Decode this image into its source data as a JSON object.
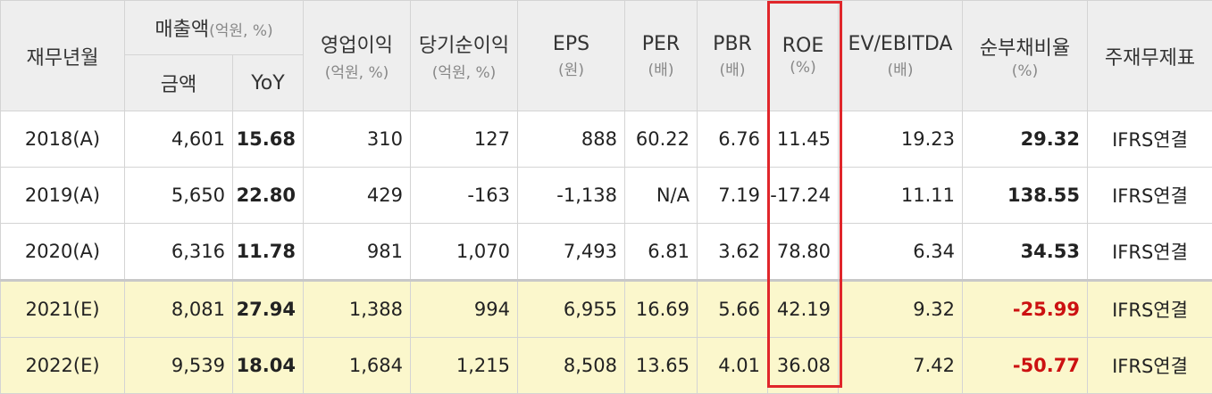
{
  "header": {
    "fiscal": "재무년월",
    "sales": {
      "label": "매출액",
      "unit": "(억원, %)",
      "amount": "금액",
      "yoy": "YoY"
    },
    "operating_profit": {
      "label": "영업이익",
      "unit": "(억원, %)"
    },
    "net_profit": {
      "label": "당기순이익",
      "unit": "(억원, %)"
    },
    "eps": {
      "label": "EPS",
      "unit": "(원)"
    },
    "per": {
      "label": "PER",
      "unit": "(배)"
    },
    "pbr": {
      "label": "PBR",
      "unit": "(배)"
    },
    "roe": {
      "label": "ROE",
      "unit": "(%)"
    },
    "ev_ebitda": {
      "label": "EV/EBITDA",
      "unit": "(배)"
    },
    "net_debt": {
      "label": "순부채비율",
      "unit": "(%)"
    },
    "statement": "주재무제표"
  },
  "rows": [
    {
      "year": "2018(A)",
      "amount": "4,601",
      "yoy": "15.68",
      "op": "310",
      "net": "127",
      "eps": "888",
      "per": "60.22",
      "pbr": "6.76",
      "roe": "11.45",
      "ev": "19.23",
      "debt": "29.32",
      "std": "IFRS연결"
    },
    {
      "year": "2019(A)",
      "amount": "5,650",
      "yoy": "22.80",
      "op": "429",
      "net": "-163",
      "eps": "-1,138",
      "per": "N/A",
      "pbr": "7.19",
      "roe": "-17.24",
      "ev": "11.11",
      "debt": "138.55",
      "std": "IFRS연결"
    },
    {
      "year": "2020(A)",
      "amount": "6,316",
      "yoy": "11.78",
      "op": "981",
      "net": "1,070",
      "eps": "7,493",
      "per": "6.81",
      "pbr": "3.62",
      "roe": "78.80",
      "ev": "6.34",
      "debt": "34.53",
      "std": "IFRS연결"
    },
    {
      "year": "2021(E)",
      "amount": "8,081",
      "yoy": "27.94",
      "op": "1,388",
      "net": "994",
      "eps": "6,955",
      "per": "16.69",
      "pbr": "5.66",
      "roe": "42.19",
      "ev": "9.32",
      "debt": "-25.99",
      "std": "IFRS연결"
    },
    {
      "year": "2022(E)",
      "amount": "9,539",
      "yoy": "18.04",
      "op": "1,684",
      "net": "1,215",
      "eps": "8,508",
      "per": "13.65",
      "pbr": "4.01",
      "roe": "36.08",
      "ev": "7.42",
      "debt": "-50.77",
      "std": "IFRS연결"
    }
  ],
  "colors": {
    "header_bg": "#eeeeee",
    "estimate_bg": "#fbf7cc",
    "negative": "#cc1111",
    "highlight": "#e0262b"
  }
}
